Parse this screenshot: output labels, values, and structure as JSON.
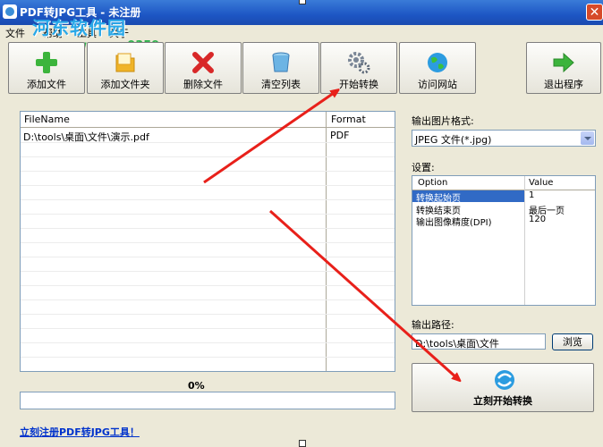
{
  "window": {
    "title": "PDF转JPG工具 - 未注册"
  },
  "watermark": {
    "text": "河东软件园",
    "url": "www.pc0359.cn"
  },
  "menu": [
    "文件",
    "帮助",
    "工具",
    "关于"
  ],
  "toolbar": {
    "add_file": "添加文件",
    "add_folder": "添加文件夹",
    "delete_file": "删除文件",
    "clear_list": "清空列表",
    "start_convert": "开始转换",
    "visit_site": "访问网站",
    "exit": "退出程序"
  },
  "file_list": {
    "headers": {
      "filename": "FileName",
      "format": "Format"
    },
    "rows": [
      {
        "file": "D:\\tools\\桌面\\文件\\演示.pdf",
        "format": "PDF"
      }
    ]
  },
  "progress": {
    "label": "0%",
    "value": 0
  },
  "register_link": "立刻注册PDF转JPG工具！",
  "output_format": {
    "label": "输出图片格式:",
    "value": "JPEG 文件(*.jpg)"
  },
  "settings": {
    "label": "设置:",
    "headers": {
      "option": "Option",
      "value": "Value"
    },
    "rows": [
      {
        "option": "转换起始页",
        "value": "1"
      },
      {
        "option": "转换结束页",
        "value": "最后一页"
      },
      {
        "option": "输出图像精度(DPI)",
        "value": "120"
      }
    ]
  },
  "output_path": {
    "label": "输出路径:",
    "value": "D:\\tools\\桌面\\文件",
    "browse": "浏览"
  },
  "start_now": "立刻开始转换",
  "colors": {
    "titlebar": "#1d56c4",
    "arrow": "#e8201a",
    "selection": "#316ac5",
    "link": "#0033cc"
  }
}
